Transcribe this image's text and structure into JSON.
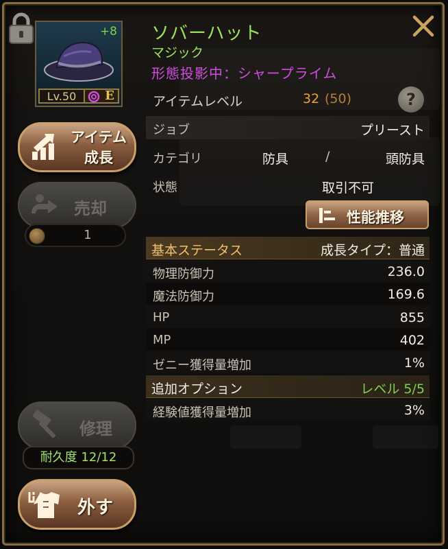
{
  "item": {
    "name": "ソバーハット",
    "rarity": "マジック",
    "projection": "形態投影中：シャープライム",
    "enhance": "+8",
    "level_badge": "Lv.50",
    "grade": "E"
  },
  "item_level": {
    "label": "アイテムレベル",
    "value": "32",
    "max": "(50)",
    "help": "?"
  },
  "details": {
    "job_label": "ジョブ",
    "job_value": "プリースト",
    "category_label": "カテゴリ",
    "category_main": "防具",
    "category_sep": "/",
    "category_sub": "頭防具",
    "state_label": "状態",
    "state_value": "取引不可"
  },
  "buttons": {
    "performance": "性能推移",
    "grow": [
      "アイテム",
      "成長"
    ],
    "sell": "売却",
    "sell_qty": "1",
    "repair": "修理",
    "durability": "耐久度 12/12",
    "remove": "外す"
  },
  "base_status": {
    "header": "基本ステータス",
    "growth_type": "成長タイプ：普通",
    "rows": [
      {
        "label": "物理防御力",
        "value": "236.0"
      },
      {
        "label": "魔法防御力",
        "value": "169.6"
      },
      {
        "label": "HP",
        "value": "855"
      },
      {
        "label": "MP",
        "value": "402"
      },
      {
        "label": "ゼニー獲得量増加",
        "value": "1%"
      }
    ]
  },
  "additional_options": {
    "header": "追加オプション",
    "level": "レベル 5/5",
    "rows": [
      {
        "label": "経験値獲得量増加",
        "value": "3%"
      }
    ]
  },
  "colors": {
    "name": "#9ee35a",
    "projection": "#d04de0",
    "item_level": "#f0a234",
    "option_level": "#7fd24a",
    "frame": "#8a6d3e"
  }
}
